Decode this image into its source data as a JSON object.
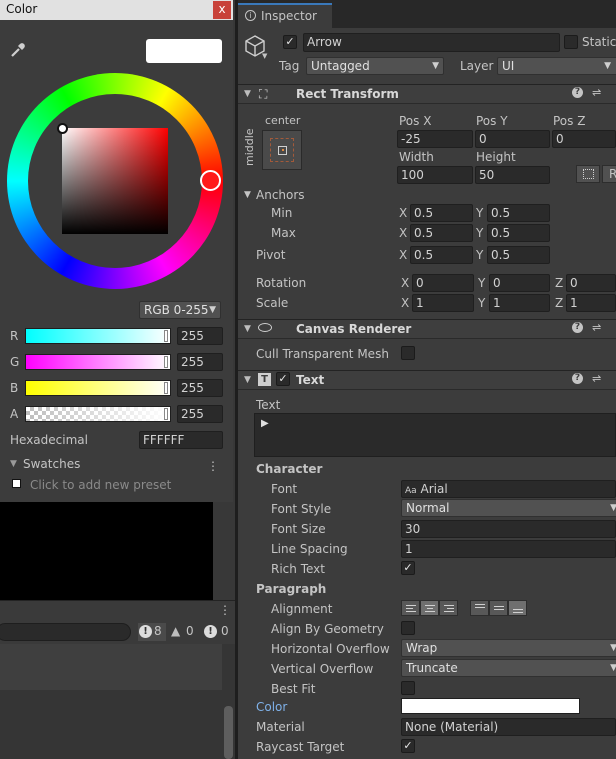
{
  "color_window": {
    "title": "Color",
    "close": "x",
    "mode": "RGB 0-255",
    "channels": [
      {
        "label": "R",
        "value": "255"
      },
      {
        "label": "G",
        "value": "255"
      },
      {
        "label": "B",
        "value": "255"
      },
      {
        "label": "A",
        "value": "255"
      }
    ],
    "hex_label": "Hexadecimal",
    "hex_value": "FFFFFF",
    "swatches_label": "Swatches",
    "swatches_hint": "Click to add new preset"
  },
  "console": {
    "error_count": "8",
    "warning_count": "0",
    "info_count": "0"
  },
  "inspector": {
    "tab": "Inspector",
    "object_name": "Arrow",
    "static_label": "Static",
    "tag_label": "Tag",
    "tag_value": "Untagged",
    "layer_label": "Layer",
    "layer_value": "UI",
    "rect_transform": {
      "title": "Rect Transform",
      "anchor_h": "center",
      "anchor_v": "middle",
      "pos_x_label": "Pos X",
      "pos_x": "-25",
      "pos_y_label": "Pos Y",
      "pos_y": "0",
      "pos_z_label": "Pos Z",
      "pos_z": "0",
      "width_label": "Width",
      "width": "100",
      "height_label": "Height",
      "height": "50",
      "r_button": "R",
      "anchors_label": "Anchors",
      "min_label": "Min",
      "min_x": "0.5",
      "min_y": "0.5",
      "max_label": "Max",
      "max_x": "0.5",
      "max_y": "0.5",
      "pivot_label": "Pivot",
      "pivot_x": "0.5",
      "pivot_y": "0.5",
      "rotation_label": "Rotation",
      "rot_x": "0",
      "rot_y": "0",
      "rot_z": "0",
      "scale_label": "Scale",
      "scale_x": "1",
      "scale_y": "1",
      "scale_z": "1",
      "x": "X",
      "y": "Y",
      "z": "Z"
    },
    "canvas_renderer": {
      "title": "Canvas Renderer",
      "cull_label": "Cull Transparent Mesh"
    },
    "text": {
      "title": "Text",
      "text_label": "Text",
      "character_label": "Character",
      "font_label": "Font",
      "font_value": "Arial",
      "font_prefix": "Aa",
      "font_style_label": "Font Style",
      "font_style_value": "Normal",
      "font_size_label": "Font Size",
      "font_size_value": "30",
      "line_spacing_label": "Line Spacing",
      "line_spacing_value": "1",
      "rich_text_label": "Rich Text",
      "paragraph_label": "Paragraph",
      "alignment_label": "Alignment",
      "align_geometry_label": "Align By Geometry",
      "h_overflow_label": "Horizontal Overflow",
      "h_overflow_value": "Wrap",
      "v_overflow_label": "Vertical Overflow",
      "v_overflow_value": "Truncate",
      "best_fit_label": "Best Fit",
      "color_label": "Color",
      "material_label": "Material",
      "material_value": "None (Material)",
      "raycast_label": "Raycast Target"
    }
  },
  "icons": {
    "check": "✓",
    "dropdown": "▼",
    "fold_open": "▼",
    "fold_closed": "▶",
    "help": "?",
    "settings": "⇌",
    "more": "⋮"
  }
}
